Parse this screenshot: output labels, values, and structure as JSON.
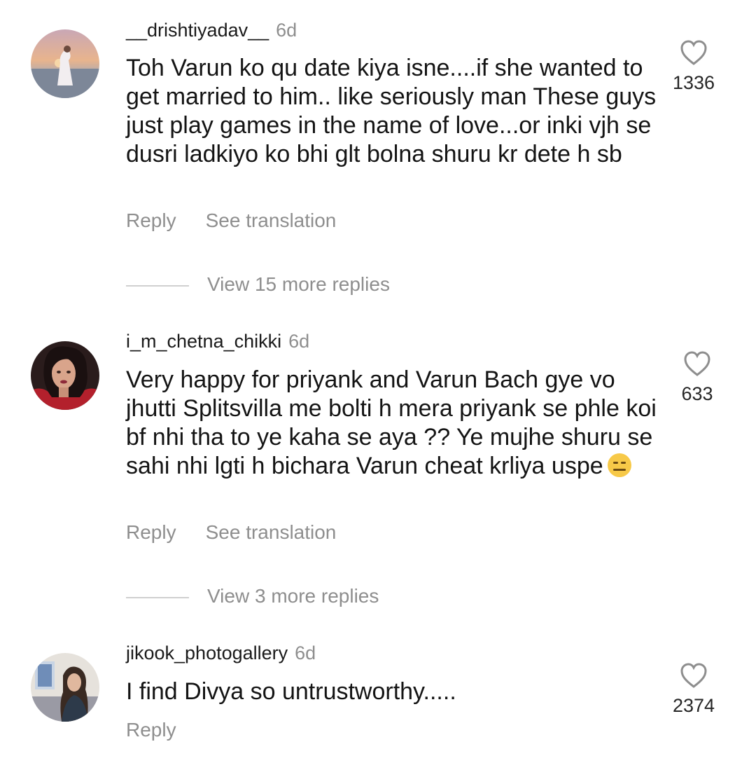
{
  "comments": [
    {
      "username": "__drishtiyadav__",
      "time": "6d",
      "text": "Toh Varun ko qu date kiya isne....if she wanted to get married to him.. like seriously man These guys just play games in the name of love...or inki vjh se dusri ladkiyo ko bhi glt bolna shuru kr dete h sb",
      "likes": "1336",
      "reply_label": "Reply",
      "translate_label": "See translation",
      "more_replies": "View 15 more replies",
      "avatar_icon": "avatar-beach-photo"
    },
    {
      "username": "i_m_chetna_chikki",
      "time": "6d",
      "text": "Very happy for priyank and Varun  Bach gye vo jhutti Splitsvilla me bolti h mera priyank se phle koi bf nhi tha to ye kaha se aya ?? Ye mujhe shuru se sahi nhi lgti h bichara Varun cheat krliya uspe",
      "emoji": "expressionless-face-icon",
      "likes": "633",
      "reply_label": "Reply",
      "translate_label": "See translation",
      "more_replies": "View 3 more replies",
      "avatar_icon": "avatar-portrait-photo"
    },
    {
      "username": "jikook_photogallery",
      "time": "6d",
      "text": "I find Divya so untrustworthy.....",
      "likes": "2374",
      "reply_label": "Reply",
      "avatar_icon": "avatar-room-photo"
    }
  ],
  "colors": {
    "secondary_text": "#8e8e8e",
    "primary_text": "#141414",
    "divider": "#d0d0d0"
  }
}
